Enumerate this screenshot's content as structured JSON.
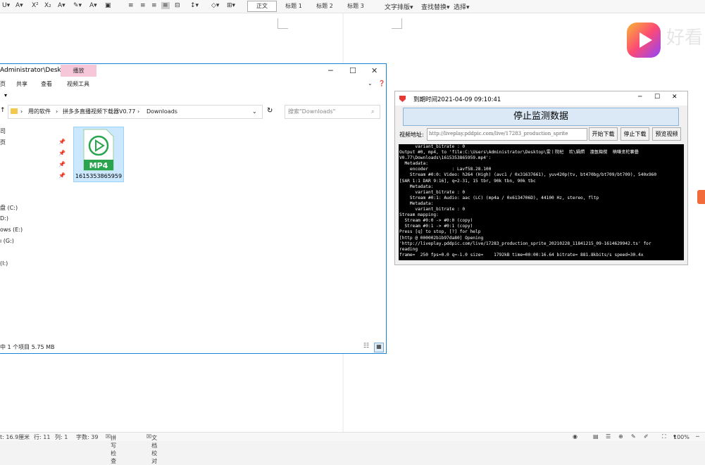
{
  "ribbon": {
    "styles": [
      "正文",
      "标题 1",
      "标题 2",
      "标题 3"
    ],
    "text_layout": "文字排版",
    "find_replace": "查找替换",
    "select": "选择"
  },
  "explorer": {
    "title": "Administrator\\Deskto...",
    "context_tab": "播放",
    "menu": [
      "共享",
      "查看",
      "视频工具"
    ],
    "breadcrumb": [
      "用的软件",
      "拼多多直播视频下载器V0.77",
      "Downloads"
    ],
    "search_placeholder": "搜索\"Downloads\"",
    "nav_items": [
      "盘 (C:)",
      "D:)",
      "ows (E:)",
      "ı (G:)",
      "(I:)"
    ],
    "file": {
      "badge": "MP4",
      "name": "1615353865959"
    },
    "status": "中 1 个项目  5.75 MB"
  },
  "monitor": {
    "title": "到期时间2021-04-09 09:10:41",
    "stop_button": "停止监测数据",
    "url_label": "视频地址:",
    "url_value": "http://liveplay.pddpic.com/live/17283_production_sprite",
    "buttons": [
      "开始下载",
      "停止下载",
      "预览视频"
    ],
    "console_lines": [
      "      variant_bitrate : 0",
      "Output #0, mp4, to 'file:C:\\Users\\Administrator\\Desktop\\雯丨院杞  欢\\鍋熌  澶氬鍧撹  楠嗛叏柁褰曡",
      "V0.77\\Downloads\\1615353865959.mp4':",
      "  Metadata:",
      "    encoder         : Lavf58.28.100",
      "    Stream #0:0: Video: h264 (High) (avc1 / 0x31637661), yuv420p(tv, bt470bg/bt709/bt709), 540x960",
      "[SAR 1:1 DAR 9:16], q=2-31, 15 tbr, 90k tbn, 90k tbc",
      "    Metadata:",
      "      variant_bitrate : 0",
      "    Stream #0:1: Audio: aac (LC) (mp4a / 0x6134706D), 44100 Hz, stereo, fltp",
      "    Metadata:",
      "      variant_bitrate : 0",
      "Stream mapping:",
      "  Stream #0:0 -> #0:0 (copy)",
      "  Stream #0:1 -> #0:1 (copy)",
      "Press [q] to stop, [?] for help",
      "[http @ 000002b1b97da80] Opening",
      "'http://liveplay.pddpic.com/live/17283_production_sprite_20210228_11841215_09-1614629942.ts' for",
      "reading",
      "frame=  250 fps=0.0 q=-1.0 size=    1792kB time=00:00:16.64 bitrate= 881.8kbits/s speed=30.4x"
    ]
  },
  "logo": {
    "text": "好看"
  },
  "word_status": {
    "page": "t: 16.9厘米",
    "row": "行: 11",
    "col": "列: 1",
    "words": "字数: 39",
    "spell": "拼写检查",
    "proof": "文档校对",
    "zoom": "100%"
  }
}
